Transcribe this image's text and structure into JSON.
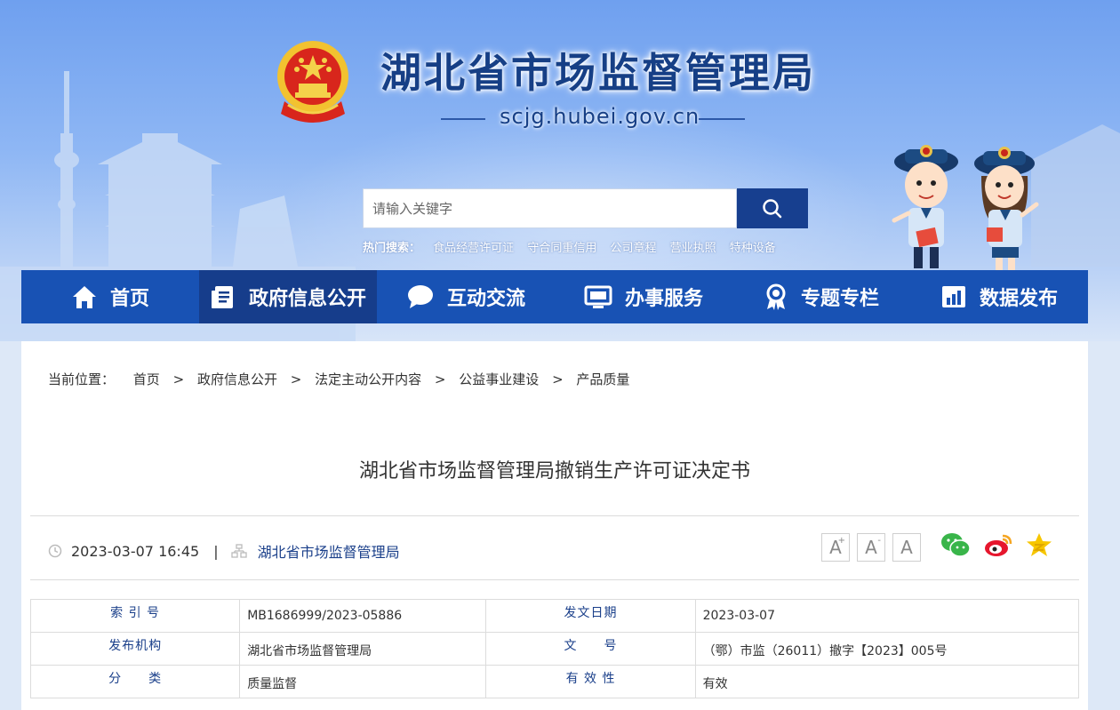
{
  "header": {
    "site_title": "湖北省市场监督管理局",
    "domain": "scjg.hubei.gov.cn",
    "search_placeholder": "请输入关键字",
    "hot_label": "热门搜索：",
    "hot_keywords": [
      "食品经营许可证",
      "守合同重信用",
      "公司章程",
      "营业执照",
      "特种设备"
    ]
  },
  "nav": [
    {
      "label": "首页",
      "icon": "home-icon"
    },
    {
      "label": "政府信息公开",
      "icon": "document-icon"
    },
    {
      "label": "互动交流",
      "icon": "chat-icon"
    },
    {
      "label": "办事服务",
      "icon": "monitor-icon"
    },
    {
      "label": "专题专栏",
      "icon": "ribbon-icon"
    },
    {
      "label": "数据发布",
      "icon": "bar-chart-icon"
    }
  ],
  "colors": {
    "nav_bg": "#1852b4",
    "nav_active": "#163d8b",
    "title_blue": "#163f86"
  },
  "breadcrumb": {
    "label": "当前位置：",
    "items": [
      "首页",
      "政府信息公开",
      "法定主动公开内容",
      "公益事业建设",
      "产品质量"
    ],
    "sep": ">"
  },
  "article": {
    "title": "湖北省市场监督管理局撤销生产许可证决定书",
    "datetime": "2023-03-07 16:45",
    "divider": "|",
    "publisher": "湖北省市场监督管理局"
  },
  "font_size": {
    "increase": "A",
    "decrease": "A",
    "reset": "A",
    "plus": "+",
    "minus": "-"
  },
  "info_table": [
    {
      "k1": "索 引 号",
      "v1": "MB1686999/2023-05886",
      "k2": "发文日期",
      "v2": "2023-03-07"
    },
    {
      "k1": "发布机构",
      "v1": "湖北省市场监督管理局",
      "k2": "文　　号",
      "v2": "（鄂）市监（26011）撤字【2023】005号"
    },
    {
      "k1": "分　　类",
      "v1": "质量监督",
      "k2": "有 效 性",
      "v2": "有效"
    }
  ]
}
